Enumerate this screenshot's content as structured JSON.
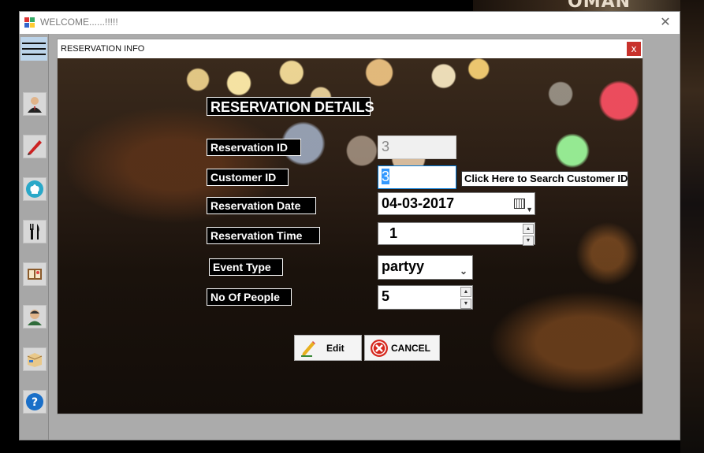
{
  "window": {
    "title": "WELCOME......!!!!!",
    "close_glyph": "✕"
  },
  "child_window": {
    "title": "RESERVATION INFO",
    "close_glyph": "x"
  },
  "form": {
    "heading": "RESERVATION DETAILS",
    "reservation_id": {
      "label": "Reservation ID",
      "value": "3"
    },
    "customer_id": {
      "label": "Customer ID",
      "value": "3"
    },
    "search_button": "Click Here to Search Customer ID",
    "reservation_date": {
      "label": "Reservation Date",
      "value": "04-03-2017"
    },
    "reservation_time": {
      "label": "Reservation Time",
      "value": "1"
    },
    "event_type": {
      "label": "Event Type",
      "value": "partyy"
    },
    "no_of_people": {
      "label": "No Of People",
      "value": "5"
    }
  },
  "buttons": {
    "edit": "Edit",
    "cancel": "CANCEL"
  },
  "toolbar_icons": [
    "customer-icon",
    "pencil-icon",
    "chef-hat-icon",
    "fork-knife-icon",
    "menu-card-icon",
    "staff-icon",
    "delivery-box-icon",
    "help-icon"
  ],
  "colors": {
    "child_close": "#c8322c",
    "highlight": "#3399ff",
    "field_focus": "#0078d7"
  }
}
